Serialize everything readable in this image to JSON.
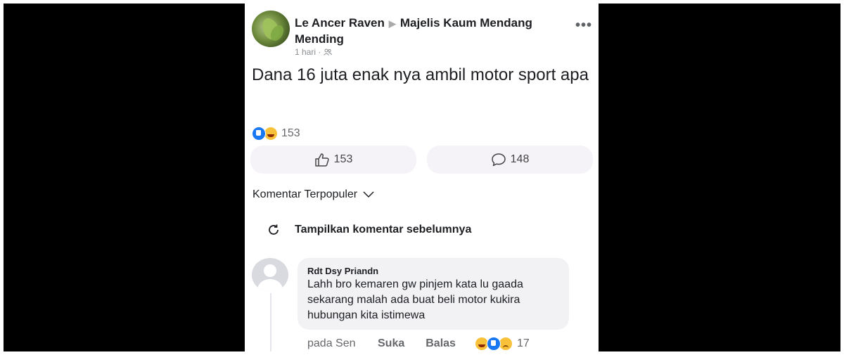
{
  "post": {
    "author": "Le Ancer Raven",
    "group": "Majelis Kaum Mendang Mending",
    "time": "1 hari",
    "audience_icon": "group-icon",
    "menu_icon": "more-icon",
    "text": "Dana 16 juta enak nya ambil motor sport apa",
    "reaction_icons": [
      "like-icon",
      "haha-icon"
    ],
    "reaction_count": "153",
    "like_count": "153",
    "comment_count": "148"
  },
  "comments_section": {
    "sort_label": "Komentar Terpopuler",
    "show_previous_label": "Tampilkan komentar sebelumnya"
  },
  "comment": {
    "author": "Rdt Dsy Priandn",
    "text": "Lahh bro kemaren gw pinjem kata lu gaada sekarang malah ada buat beli motor kukira hubungan kita istimewa",
    "time": "pada Sen",
    "like_label": "Suka",
    "reply_label": "Balas",
    "reaction_icons": [
      "haha-icon",
      "like-icon",
      "sad-icon"
    ],
    "reaction_count": "17"
  },
  "colors": {
    "like_blue": "#1877f2",
    "emoji_yellow": "#f7c13a",
    "button_bg": "#f6f3f8",
    "bubble_bg": "#f2f2f5"
  }
}
